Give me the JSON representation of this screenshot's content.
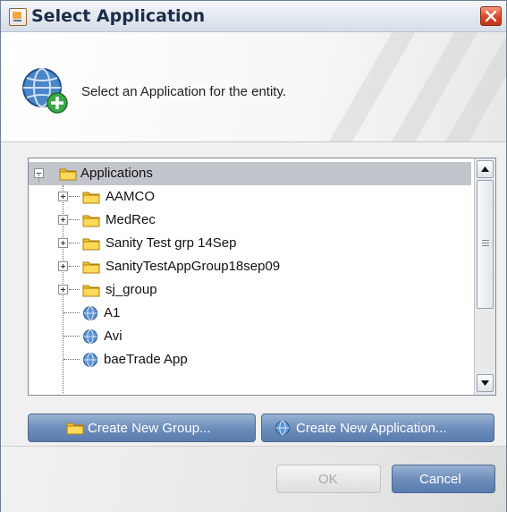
{
  "window": {
    "title": "Select Application"
  },
  "header": {
    "message": "Select an Application for the entity."
  },
  "tree": {
    "root": {
      "label": "Applications",
      "icon": "folder-icon",
      "expanded": true
    },
    "groups": [
      {
        "label": "AAMCO",
        "icon": "folder-icon"
      },
      {
        "label": "MedRec",
        "icon": "folder-icon"
      },
      {
        "label": "Sanity Test grp 14Sep",
        "icon": "folder-icon"
      },
      {
        "label": "SanityTestAppGroup18sep09",
        "icon": "folder-icon"
      },
      {
        "label": "sj_group",
        "icon": "folder-icon"
      }
    ],
    "applications": [
      {
        "label": "A1",
        "icon": "globe-icon"
      },
      {
        "label": "Avi",
        "icon": "globe-icon"
      },
      {
        "label": "baeTrade App",
        "icon": "globe-icon"
      }
    ]
  },
  "actions": {
    "create_group": "Create New Group...",
    "create_application": "Create New Application..."
  },
  "footer": {
    "ok": "OK",
    "cancel": "Cancel"
  },
  "colors": {
    "accent": "#6d8ebb",
    "selection": "#c2c6cc",
    "close": "#d8452a"
  }
}
